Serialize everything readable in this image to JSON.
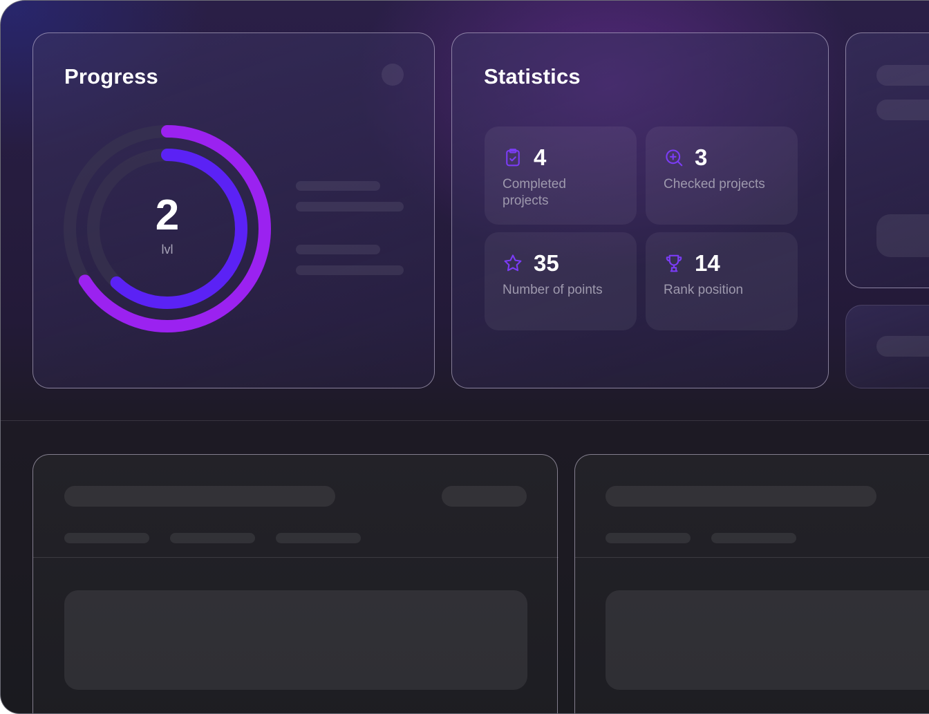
{
  "progress": {
    "title": "Progress",
    "level_value": "2",
    "level_label": "lvl",
    "outer_ring_fraction": 0.66,
    "inner_ring_fraction": 0.62,
    "colors": {
      "outer": "#9b22f0",
      "inner": "#5b22f5",
      "track": "#3a3650"
    }
  },
  "statistics": {
    "title": "Statistics",
    "tiles": [
      {
        "value": "4",
        "label": "Completed projects",
        "icon": "clipboard-check-icon"
      },
      {
        "value": "3",
        "label": "Checked projects",
        "icon": "search-plus-icon"
      },
      {
        "value": "35",
        "label": "Number of points",
        "icon": "star-icon"
      },
      {
        "value": "14",
        "label": "Rank position",
        "icon": "trophy-icon"
      }
    ],
    "icon_color": "#7b3cf5"
  }
}
